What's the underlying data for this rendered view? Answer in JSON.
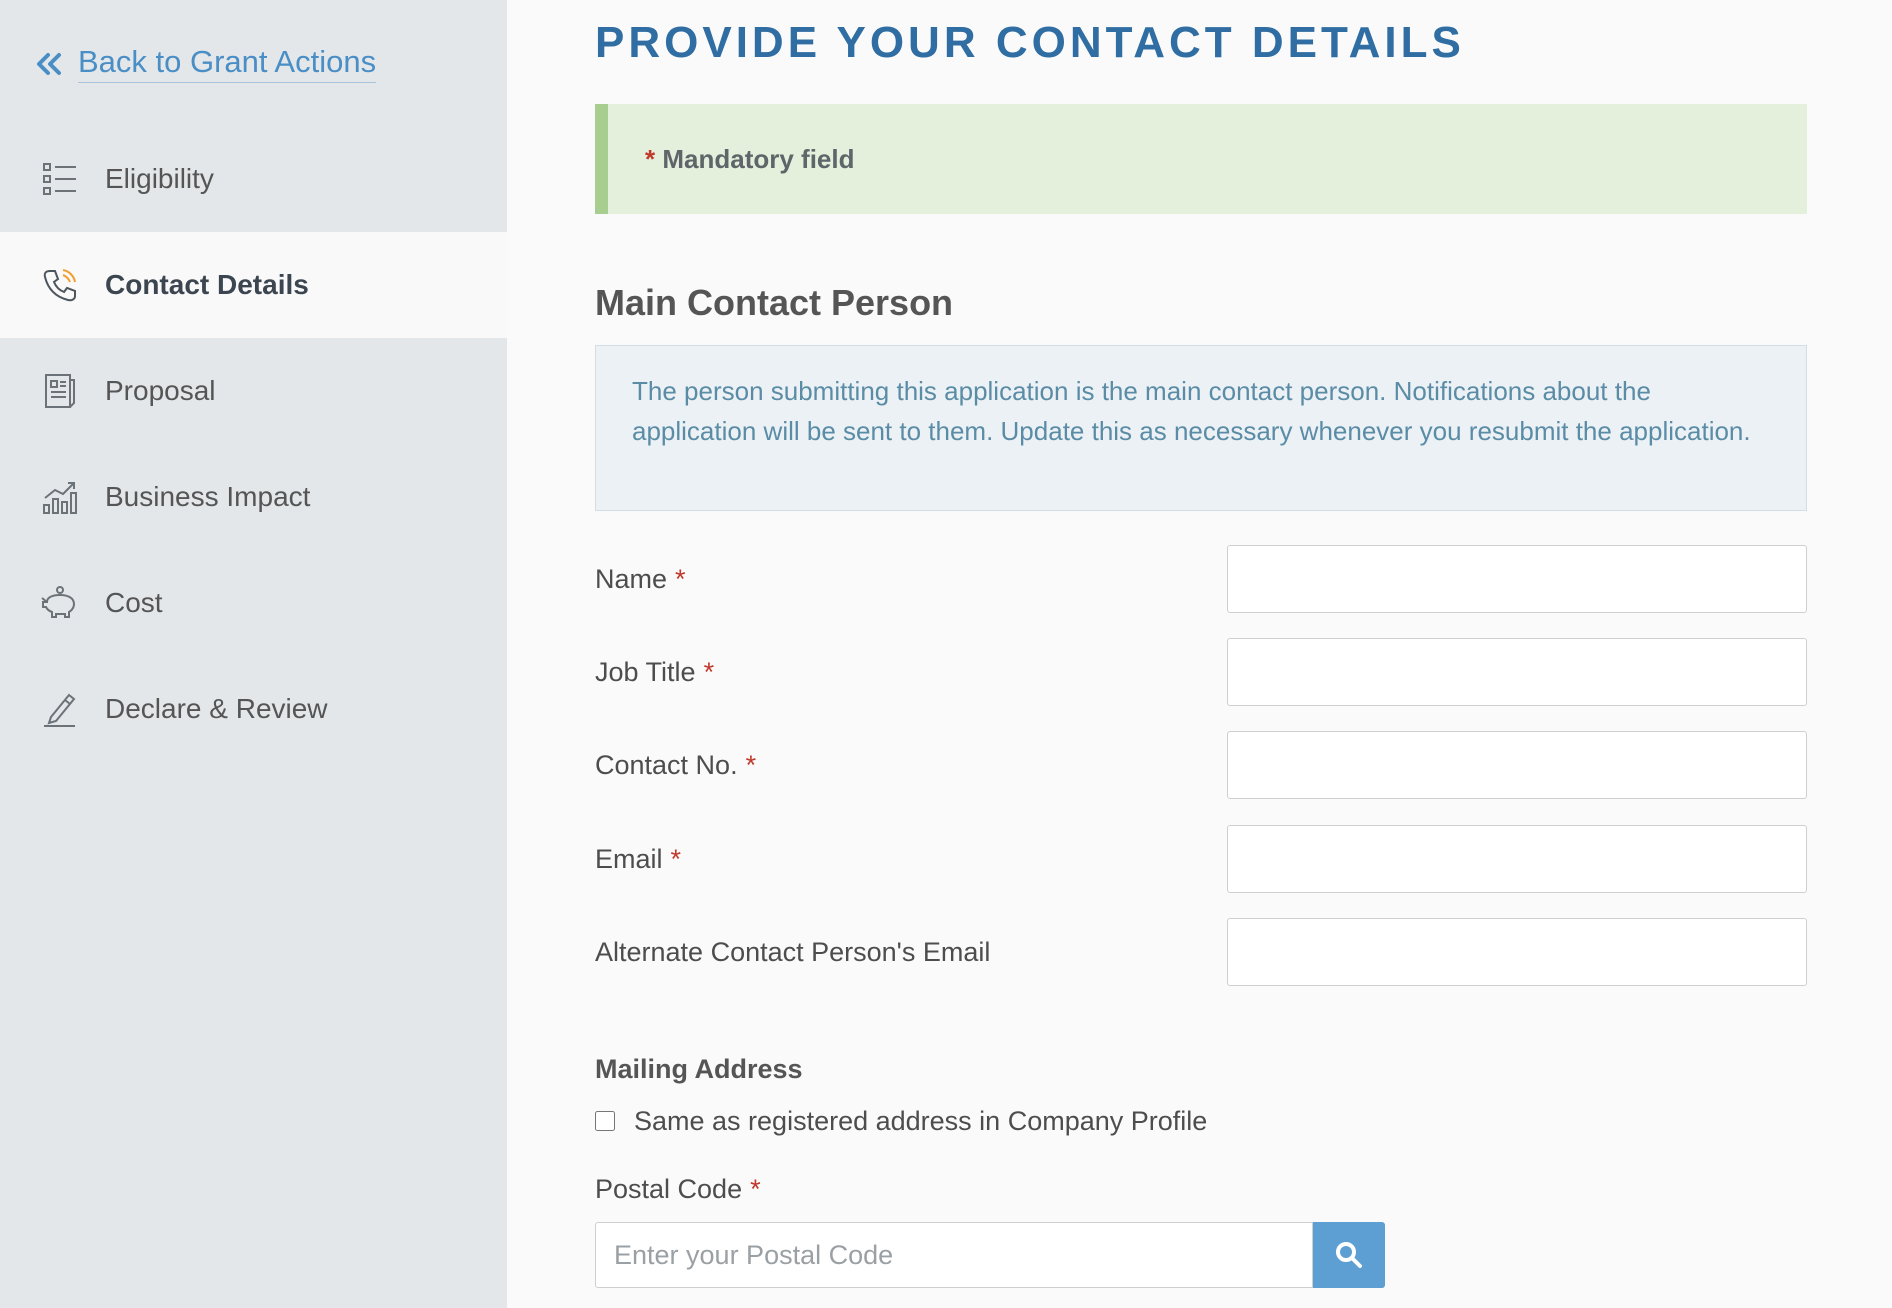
{
  "sidebar": {
    "back_label": "Back to Grant Actions",
    "items": [
      {
        "label": "Eligibility",
        "icon": "list-icon"
      },
      {
        "label": "Contact Details",
        "icon": "phone-icon",
        "active": true
      },
      {
        "label": "Proposal",
        "icon": "document-icon"
      },
      {
        "label": "Business Impact",
        "icon": "chart-icon"
      },
      {
        "label": "Cost",
        "icon": "piggy-bank-icon"
      },
      {
        "label": "Declare & Review",
        "icon": "pen-icon"
      }
    ]
  },
  "main": {
    "page_title": "PROVIDE YOUR CONTACT DETAILS",
    "mandatory_note": "Mandatory field",
    "required_marker": "*",
    "section_title": "Main Contact Person",
    "info_text": "The person submitting this application is the main contact person. Notifications about the application will be sent to them. Update this as necessary whenever you resubmit the application.",
    "fields": [
      {
        "label": "Name",
        "required": true,
        "value": ""
      },
      {
        "label": "Job Title",
        "required": true,
        "value": ""
      },
      {
        "label": "Contact No.",
        "required": true,
        "value": ""
      },
      {
        "label": "Email",
        "required": true,
        "value": ""
      },
      {
        "label": "Alternate Contact Person's Email",
        "required": false,
        "value": ""
      }
    ],
    "mailing_address": {
      "title": "Mailing Address",
      "same_as_label": "Same as registered address in Company Profile",
      "same_as_checked": false,
      "postal_label": "Postal Code",
      "postal_placeholder": "Enter your Postal Code",
      "postal_value": ""
    }
  },
  "colors": {
    "title_blue": "#2f6da3",
    "link_blue": "#4a8ec6",
    "required_red": "#c0392b",
    "mandatory_bg": "#e4efdc",
    "mandatory_border": "#a7ce8f",
    "info_text": "#5b8ca6",
    "search_button": "#5d9fd3",
    "phone_icon_accent": "#f0a030"
  }
}
